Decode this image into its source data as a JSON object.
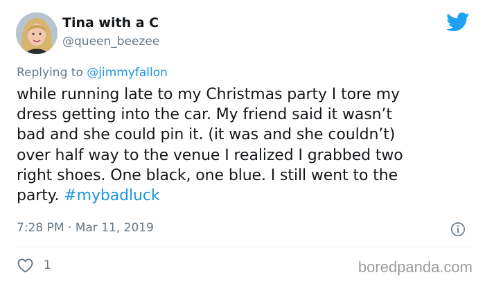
{
  "author": {
    "display_name": "Tina with a C",
    "handle": "@queen_beezee",
    "avatar_icon": "profile-photo"
  },
  "reply": {
    "prefix": "Replying to ",
    "mention": "@jimmyfallon"
  },
  "body": {
    "lines": [
      "while running late to my Christmas party I tore my",
      "dress getting into the car. My friend said it wasn’t",
      "bad and she could pin it. (it was and she couldn’t)",
      "over half way to the venue I realized I grabbed two",
      "right shoes. One black, one blue. I still went to the",
      "party. "
    ],
    "hashtag": "#mybadluck"
  },
  "meta": {
    "timestamp": "7:28 PM · Mar 11, 2019"
  },
  "actions": {
    "like_count": "1"
  },
  "watermark": "boredpanda.com",
  "colors": {
    "brand_blue": "#1da1f2",
    "link_blue": "#1b95e0",
    "secondary_text": "#657786",
    "primary_text": "#14171a"
  },
  "icons": {
    "logo": "twitter-bird-icon",
    "info": "info-icon",
    "like": "heart-icon"
  }
}
